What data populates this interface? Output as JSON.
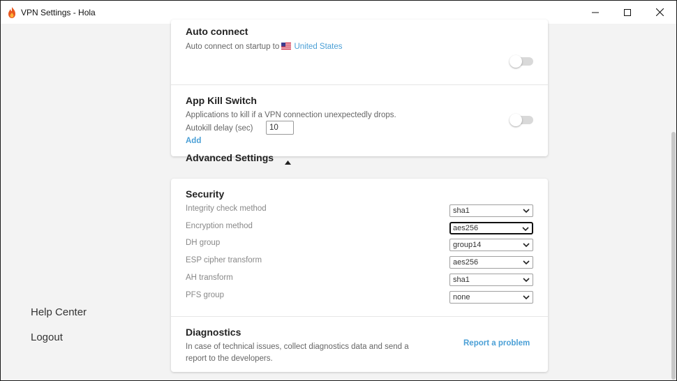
{
  "window": {
    "title": "VPN Settings - Hola"
  },
  "sidebar": {
    "help_center": "Help Center",
    "logout": "Logout"
  },
  "auto_connect": {
    "title": "Auto connect",
    "desc_prefix": "Auto connect on startup to",
    "country": "United States",
    "enabled": false
  },
  "kill_switch": {
    "title": "App Kill Switch",
    "desc": "Applications to kill if a VPN connection unexpectedly drops.",
    "delay_label": "Autokill delay (sec)",
    "delay_value": "10",
    "add_label": "Add",
    "enabled": false
  },
  "advanced": {
    "title": "Advanced Settings",
    "expanded": true
  },
  "security": {
    "title": "Security",
    "rows": [
      {
        "label": "Integrity check method",
        "value": "sha1"
      },
      {
        "label": "Encryption method",
        "value": "aes256"
      },
      {
        "label": "DH group",
        "value": "group14"
      },
      {
        "label": "ESP cipher transform",
        "value": "aes256"
      },
      {
        "label": "AH transform",
        "value": "sha1"
      },
      {
        "label": "PFS group",
        "value": "none"
      }
    ]
  },
  "diagnostics": {
    "title": "Diagnostics",
    "desc_line1": "In case of technical issues, collect diagnostics data and send a",
    "desc_line2": "report to the developers.",
    "report_link": "Report a problem"
  },
  "colors": {
    "link": "#4a9fd6",
    "toggle_off": "#d9d9d9",
    "app_icon": "#e8571f"
  },
  "icons": {
    "app": "flame-icon",
    "minimize": "minimize-icon",
    "maximize": "maximize-icon",
    "close": "close-icon",
    "flag": "us-flag-icon",
    "caret": "caret-up-icon",
    "dropdown": "chevron-down-icon"
  }
}
